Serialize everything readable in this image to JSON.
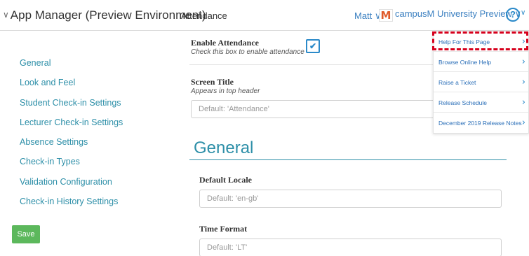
{
  "header": {
    "app_title": "App Manager (Preview Environment)",
    "page_name": "Attendance",
    "user": "Matt",
    "environment": "campusM University Preview",
    "logo_letter": "M",
    "help_glyph": "?"
  },
  "sidebar": {
    "items": [
      {
        "label": "General"
      },
      {
        "label": "Look and Feel"
      },
      {
        "label": "Student Check-in Settings"
      },
      {
        "label": "Lecturer Check-in Settings"
      },
      {
        "label": "Absence Settings"
      },
      {
        "label": "Check-in Types"
      },
      {
        "label": "Validation Configuration"
      },
      {
        "label": "Check-in History Settings"
      }
    ],
    "save_label": "Save"
  },
  "main": {
    "enable_attendance": {
      "label": "Enable Attendance",
      "hint": "Check this box to enable attendance",
      "checked": true
    },
    "screen_title": {
      "label": "Screen Title",
      "hint": "Appears in top header",
      "placeholder": "Default: 'Attendance'"
    },
    "section_title": "General",
    "default_locale": {
      "label": "Default Locale",
      "placeholder": "Default: 'en-gb'"
    },
    "time_format": {
      "label": "Time Format",
      "placeholder": "Default: 'LT'"
    }
  },
  "help_menu": {
    "items": [
      {
        "label": "Help For This Page"
      },
      {
        "label": "Browse Online Help"
      },
      {
        "label": "Raise a Ticket"
      },
      {
        "label": "Release Schedule"
      },
      {
        "label": "December 2019 Release Notes"
      }
    ]
  },
  "colors": {
    "accent": "#2d8fa8",
    "link": "#3a7fc0",
    "save_button": "#5cb85c",
    "highlight": "#d6001c"
  },
  "icons": {
    "checkbox_checked": "check-icon",
    "dropdown": "chevron-down-icon",
    "menu_item": "chevron-right-icon",
    "help": "help-circle-icon"
  }
}
